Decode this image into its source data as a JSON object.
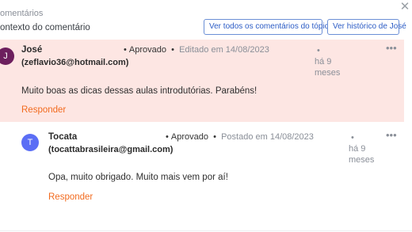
{
  "header": {
    "title": "omentários",
    "context_label": "ontexto do comentário",
    "close_icon": "close-icon",
    "buttons": {
      "topic": "Ver todos os comentários do tópico",
      "history": "Ver histórico de José"
    }
  },
  "comments": [
    {
      "avatar_initial": "J",
      "avatar_color": "#6d1f5e",
      "author": "José",
      "email": "(zeflavio36@hotmail.com)",
      "status": "Aprovado",
      "date_text": "Editado em 14/08/2023",
      "ago_line1": "há 9",
      "ago_line2": "meses",
      "body": "Muito boas as dicas dessas aulas introdutórias. Parabéns!",
      "reply_label": "Responder",
      "background": "#fde6e3"
    },
    {
      "avatar_initial": "T",
      "avatar_color": "#5b6ef5",
      "author": "Tocata",
      "email": "(tocattabrasileira@gmail.com)",
      "status": "Aprovado",
      "date_text": "Postado em 14/08/2023",
      "ago_line1": "há 9",
      "ago_line2": "meses",
      "body": "Opa, muito obrigado. Muito mais vem por aí!",
      "reply_label": "Responder",
      "background": "#ffffff"
    }
  ],
  "colors": {
    "accent_reply": "#f26b1f",
    "button_border": "#6b8fd6",
    "button_text": "#2c5cc5"
  }
}
